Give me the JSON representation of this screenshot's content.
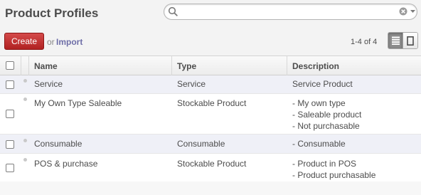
{
  "header": {
    "title": "Product Profiles",
    "search": {
      "value": "",
      "placeholder": ""
    }
  },
  "toolbar": {
    "create_label": "Create",
    "or_label": "or",
    "import_label": "Import",
    "pager": "1-4 of 4"
  },
  "table": {
    "columns": [
      "Name",
      "Type",
      "Description"
    ],
    "rows": [
      {
        "name": "Service",
        "type": "Service",
        "description": [
          "Service Product"
        ]
      },
      {
        "name": "My Own Type Saleable",
        "type": "Stockable Product",
        "description": [
          "- My own type",
          "- Saleable product",
          "- Not purchasable"
        ]
      },
      {
        "name": "Consumable",
        "type": "Consumable",
        "description": [
          "- Consumable"
        ]
      },
      {
        "name": "POS & purchase",
        "type": "Stockable Product",
        "description": [
          "- Product in POS",
          "- Product purchasable"
        ]
      }
    ]
  },
  "colors": {
    "accent": "#b12222",
    "link": "#6f6fa8",
    "row_highlight": "#eff0f7"
  },
  "icons": [
    "search-icon",
    "clear-icon",
    "chevron-down-icon",
    "list-view-icon",
    "form-view-icon",
    "drag-handle-icon"
  ]
}
